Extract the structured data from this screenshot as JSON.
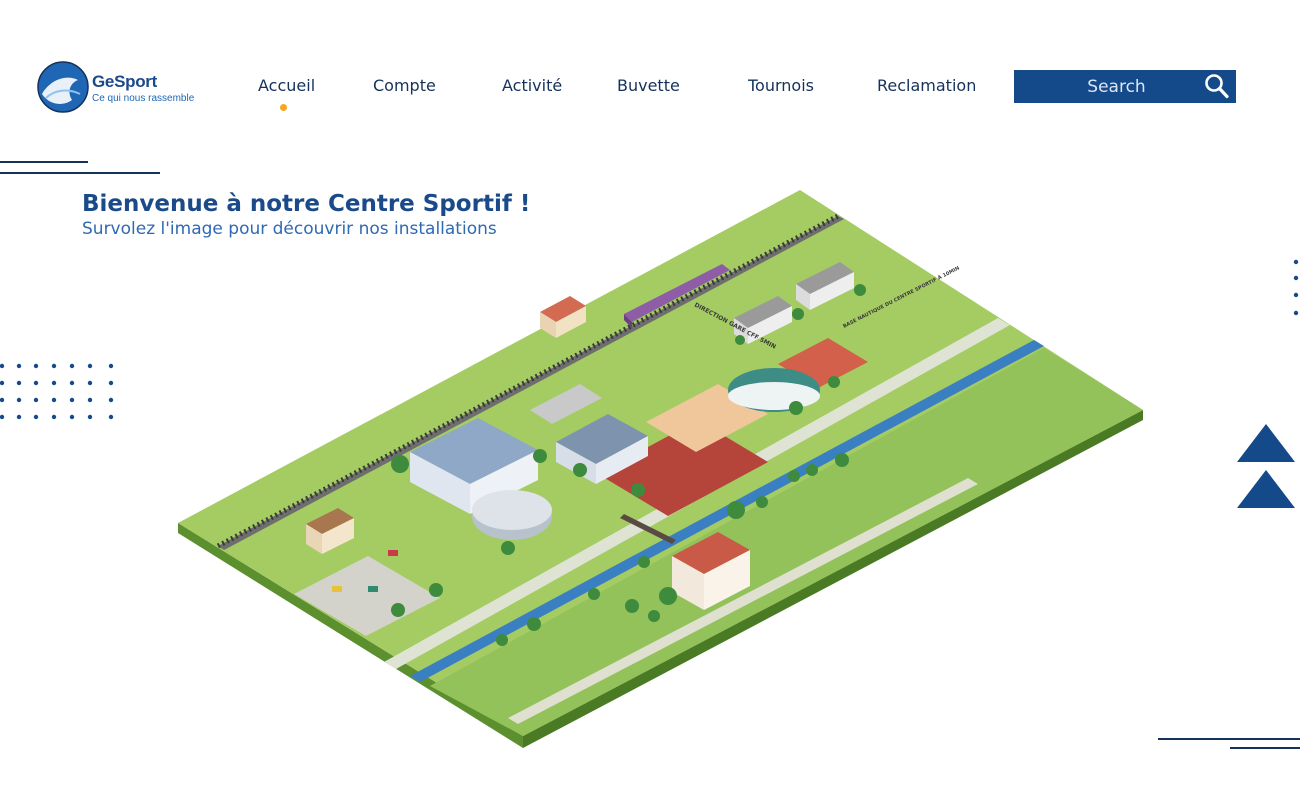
{
  "header": {
    "logo": {
      "name": "GeSport",
      "tagline": "Ce qui nous rassemble"
    },
    "nav": [
      {
        "label": "Accueil",
        "active": true
      },
      {
        "label": "Compte",
        "active": false
      },
      {
        "label": "Activité",
        "active": false
      },
      {
        "label": "Buvette",
        "active": false
      },
      {
        "label": "Tournois",
        "active": false
      },
      {
        "label": "Reclamation",
        "active": false
      }
    ],
    "search": {
      "placeholder": "Search",
      "icon": "search-icon"
    }
  },
  "hero": {
    "title": "Bienvenue à notre Centre Sportif !",
    "subtitle": "Survolez l'image pour découvrir nos installations"
  },
  "map": {
    "sign_station": "DIRECTION GARE CFF 5MIN",
    "sign_nautical": "BASE NAUTIQUE DU CENTRE SPORTIF À 10MIN"
  },
  "colors": {
    "primary": "#154a8a",
    "accent": "#f5a623",
    "grass": "#9cc65a",
    "water": "#3a7fc2"
  }
}
